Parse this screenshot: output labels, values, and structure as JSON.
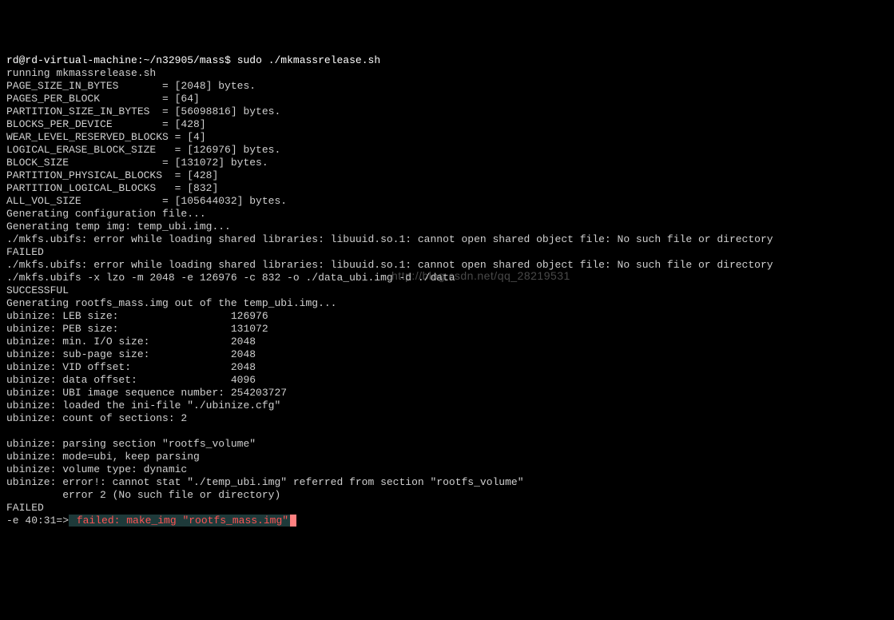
{
  "prompt": {
    "user": "rd@rd-virtual-machine",
    "path": "~/n32905/mass",
    "sep": "$",
    "cmd": "sudo ./mkmassrelease.sh"
  },
  "lines": {
    "l01": "running mkmassrelease.sh",
    "l02": "PAGE_SIZE_IN_BYTES       = [2048] bytes.",
    "l03": "PAGES_PER_BLOCK          = [64]",
    "l04": "PARTITION_SIZE_IN_BYTES  = [56098816] bytes.",
    "l05": "BLOCKS_PER_DEVICE        = [428]",
    "l06": "WEAR_LEVEL_RESERVED_BLOCKS = [4]",
    "l07": "LOGICAL_ERASE_BLOCK_SIZE   = [126976] bytes.",
    "l08": "BLOCK_SIZE               = [131072] bytes.",
    "l09": "PARTITION_PHYSICAL_BLOCKS  = [428]",
    "l10": "PARTITION_LOGICAL_BLOCKS   = [832]",
    "l11": "ALL_VOL_SIZE             = [105644032] bytes.",
    "l12": "Generating configuration file...",
    "l13": "Generating temp img: temp_ubi.img...",
    "l14": "./mkfs.ubifs: error while loading shared libraries: libuuid.so.1: cannot open shared object file: No such file or directory",
    "l15": "FAILED",
    "l16": "./mkfs.ubifs: error while loading shared libraries: libuuid.so.1: cannot open shared object file: No such file or directory",
    "l17": "./mkfs.ubifs -x lzo -m 2048 -e 126976 -c 832 -o ./data_ubi.img -d ./data",
    "l18": "SUCCESSFUL",
    "l19": "Generating rootfs_mass.img out of the temp_ubi.img...",
    "l20": "ubinize: LEB size:                  126976",
    "l21": "ubinize: PEB size:                  131072",
    "l22": "ubinize: min. I/O size:             2048",
    "l23": "ubinize: sub-page size:             2048",
    "l24": "ubinize: VID offset:                2048",
    "l25": "ubinize: data offset:               4096",
    "l26": "ubinize: UBI image sequence number: 254203727",
    "l27": "ubinize: loaded the ini-file \"./ubinize.cfg\"",
    "l28": "ubinize: count of sections: 2",
    "l29": "",
    "l30": "ubinize: parsing section \"rootfs_volume\"",
    "l31": "ubinize: mode=ubi, keep parsing",
    "l32": "ubinize: volume type: dynamic",
    "l33": "ubinize: error!: cannot stat \"./temp_ubi.img\" referred from section \"rootfs_volume\"",
    "l34": "         error 2 (No such file or directory)",
    "l35": "FAILED"
  },
  "fail_line": {
    "prefix": "-e 40:31=>",
    "text": " failed: make_img \"rootfs_mass.img\""
  },
  "watermark": "http://blog.csdn.net/qq_28219531"
}
